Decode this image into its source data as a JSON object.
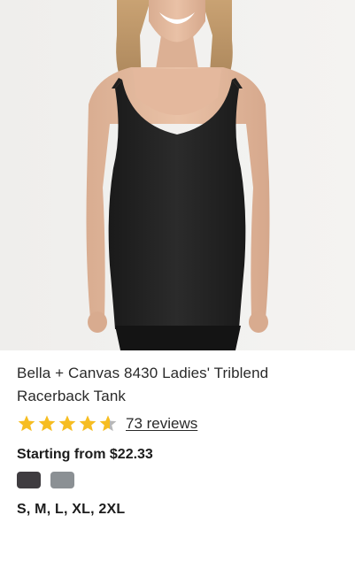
{
  "product": {
    "title": "Bella + Canvas 8430 Ladies' Triblend Racerback Tank",
    "rating": 4.6,
    "rating_max": 5,
    "reviews_label": "73 reviews",
    "price_label": "Starting from $22.33",
    "sizes_label": "S, M, L, XL, 2XL",
    "colors": [
      {
        "name": "dark-charcoal-swatch",
        "hex": "#3f3c40"
      },
      {
        "name": "grey-swatch",
        "hex": "#8b9094"
      }
    ]
  },
  "theme": {
    "star_filled": "#f6bd22",
    "star_empty": "#b8b8b8"
  }
}
